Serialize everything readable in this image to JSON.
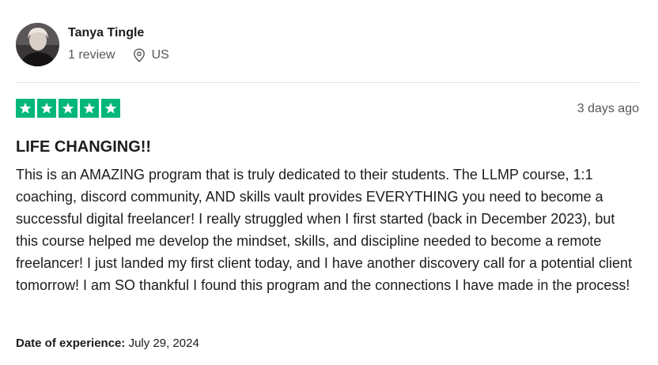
{
  "reviewer": {
    "name": "Tanya Tingle",
    "review_count": "1 review",
    "country": "US"
  },
  "rating": {
    "stars": 5,
    "max": 5,
    "color": "#00b67a"
  },
  "review": {
    "date": "3 days ago",
    "title": "LIFE CHANGING!!",
    "body": "This is an AMAZING program that is truly dedicated to their students. The LLMP course, 1:1 coaching, discord community, AND skills vault provides EVERYTHING you need to become a successful digital freelancer! I really struggled when I first started (back in December 2023), but this course helped me develop the mindset, skills, and discipline needed to become a remote freelancer! I just landed my first client today, and I have another discovery call for a potential client tomorrow! I am SO thankful I found this program and the connections I have made in the process!",
    "experience_label": "Date of experience:",
    "experience_date": "July 29, 2024"
  },
  "icons": {
    "location": "map-pin-icon",
    "star": "star-icon"
  }
}
